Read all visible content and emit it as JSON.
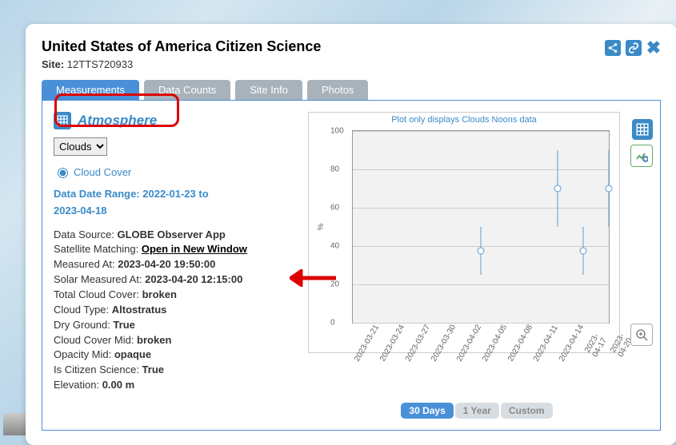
{
  "header": {
    "title": "United States of America Citizen Science",
    "site_label": "Site:",
    "site_id": "12TTS720933"
  },
  "tabs": [
    {
      "label": "Measurements",
      "active": true
    },
    {
      "label": "Data Counts",
      "active": false
    },
    {
      "label": "Site Info",
      "active": false
    },
    {
      "label": "Photos",
      "active": false
    }
  ],
  "section": {
    "title": "Atmosphere"
  },
  "select": {
    "value": "Clouds"
  },
  "radio": {
    "label": "Cloud Cover"
  },
  "date_range": {
    "label": "Data Date Range:",
    "start": "2022-01-23",
    "to": "to",
    "end": "2023-04-18"
  },
  "fields": [
    {
      "label": "Data Source:",
      "value": "GLOBE Observer App"
    },
    {
      "label": "Satellite Matching:",
      "value": "Open in New Window",
      "link": true
    },
    {
      "label": "Measured At:",
      "value": "2023-04-20 19:50:00"
    },
    {
      "label": "Solar Measured At:",
      "value": "2023-04-20 12:15:00"
    },
    {
      "label": "Total Cloud Cover:",
      "value": "broken"
    },
    {
      "label": "Cloud Type:",
      "value": "Altostratus"
    },
    {
      "label": "Dry Ground:",
      "value": "True"
    },
    {
      "label": "Cloud Cover Mid:",
      "value": "broken"
    },
    {
      "label": "Opacity Mid:",
      "value": "opaque"
    },
    {
      "label": "Is Citizen Science:",
      "value": "True"
    },
    {
      "label": "Elevation:",
      "value": "0.00 m"
    }
  ],
  "chart_data": {
    "type": "scatter",
    "title": "Plot only displays Clouds Noons data",
    "ylabel": "%",
    "ylim": [
      0,
      100
    ],
    "yticks": [
      0,
      20,
      40,
      60,
      80,
      100
    ],
    "categories": [
      "2023-03-21",
      "2023-03-24",
      "2023-03-27",
      "2023-03-30",
      "2023-04-02",
      "2023-04-05",
      "2023-04-08",
      "2023-04-11",
      "2023-04-14",
      "2023-04-17",
      "2023-04-20"
    ],
    "points": [
      {
        "x": "2023-04-05",
        "y": 37.5,
        "err": 12.5
      },
      {
        "x": "2023-04-14",
        "y": 70,
        "err": 20
      },
      {
        "x": "2023-04-17",
        "y": 37.5,
        "err": 12.5
      },
      {
        "x": "2023-04-20",
        "y": 70,
        "err": 20
      }
    ]
  },
  "range": [
    {
      "label": "30 Days",
      "active": true
    },
    {
      "label": "1 Year",
      "active": false
    },
    {
      "label": "Custom",
      "active": false
    }
  ]
}
